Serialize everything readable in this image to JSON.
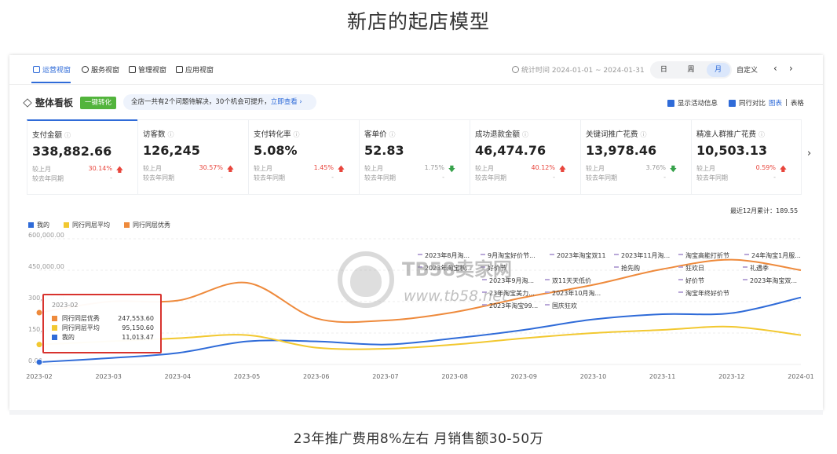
{
  "slide": {
    "title": "新店的起店模型",
    "caption": "23年推广费用8%左右 月销售额30-50万"
  },
  "topbar": {
    "tabs": [
      {
        "label": "运营视窗",
        "active": true
      },
      {
        "label": "服务视窗",
        "active": false
      },
      {
        "label": "管理视窗",
        "active": false
      },
      {
        "label": "应用视窗",
        "active": false
      }
    ],
    "stat_time": "统计时间 2024-01-01 ~ 2024-01-31",
    "periods": [
      "日",
      "周",
      "月"
    ],
    "active_period": "月",
    "custom": "自定义",
    "prev": "‹",
    "next": "›"
  },
  "section": {
    "title": "整体看板",
    "one_key": "一键转化",
    "notice": "全店一共有2个问题待解决，30个机会可提升，",
    "notice_link": "立即查看 ›",
    "show_activity": "显示活动信息",
    "peer_compare": "同行对比",
    "view_chart": "图表",
    "view_sep": " | ",
    "view_table": "表格"
  },
  "metrics": [
    {
      "label": "支付金额",
      "value": "338,882.66",
      "mom_label": "较上月",
      "mom": "30.14%",
      "dir": "up",
      "yoy_label": "较去年同期",
      "yoy": "-"
    },
    {
      "label": "访客数",
      "value": "126,245",
      "mom_label": "较上月",
      "mom": "30.57%",
      "dir": "up",
      "yoy_label": "较去年同期",
      "yoy": "-"
    },
    {
      "label": "支付转化率",
      "value": "5.08%",
      "mom_label": "较上月",
      "mom": "1.45%",
      "dir": "up",
      "yoy_label": "较去年同期",
      "yoy": "-"
    },
    {
      "label": "客单价",
      "value": "52.83",
      "mom_label": "较上月",
      "mom": "1.75%",
      "dir": "down",
      "yoy_label": "较去年同期",
      "yoy": "-"
    },
    {
      "label": "成功退款金额",
      "value": "46,474.76",
      "mom_label": "较上月",
      "mom": "40.12%",
      "dir": "up",
      "yoy_label": "较去年同期",
      "yoy": "-"
    },
    {
      "label": "关键词推广花费",
      "value": "13,978.46",
      "mom_label": "较上月",
      "mom": "3.76%",
      "dir": "down",
      "yoy_label": "较去年同期",
      "yoy": "-"
    },
    {
      "label": "精准人群推广花费",
      "value": "10,503.13",
      "mom_label": "较上月",
      "mom": "0.59%",
      "dir": "up",
      "yoy_label": "较去年同期",
      "yoy": "-"
    }
  ],
  "accum_label": "最近12月累计：189.55",
  "watermark": {
    "line1": "TB58卖家网",
    "line2": "www.tb58.net"
  },
  "chart_data": {
    "type": "line",
    "x": [
      "2023-02",
      "2023-03",
      "2023-04",
      "2023-05",
      "2023-06",
      "2023-07",
      "2023-08",
      "2023-09",
      "2023-10",
      "2023-11",
      "2023-12",
      "2024-01"
    ],
    "y_ticks": [
      "600,000.00",
      "450,000.00",
      "300,000.00",
      "150,000.00",
      "0.00"
    ],
    "ylim": [
      0,
      600000
    ],
    "legend_position": "top-left",
    "series": [
      {
        "name": "我的",
        "color": "#2f6bd8",
        "values": [
          11013,
          30000,
          55000,
          110000,
          110000,
          95000,
          125000,
          165000,
          215000,
          240000,
          245000,
          320000
        ]
      },
      {
        "name": "同行同层平均",
        "color": "#f2c830",
        "values": [
          95150,
          110000,
          125000,
          140000,
          80000,
          75000,
          95000,
          125000,
          150000,
          165000,
          180000,
          140000
        ]
      },
      {
        "name": "同行同层优秀",
        "color": "#ee8a3c",
        "values": [
          247553,
          300000,
          305000,
          390000,
          220000,
          210000,
          250000,
          320000,
          380000,
          455000,
          500000,
          450000
        ]
      }
    ],
    "annotations": [
      [
        "2023年8月淘...",
        "9月淘宝好价节...",
        "2023年淘宝双11",
        "2023年11月淘...",
        "淘宝高能打折节",
        "24年淘宝1月服..."
      ],
      [
        "2023年淘宝秋...",
        "好价节",
        "抢先购",
        "狂欢日",
        "礼遇季"
      ],
      [
        "2023年9月淘...",
        "双11天天低价",
        "好价节",
        "2023年淘宝双..."
      ],
      [
        "23年淘宝美力...",
        "2023年10月淘...",
        "淘宝年终好价节"
      ],
      [
        "2023年淘宝99...",
        "国庆狂欢"
      ]
    ],
    "tooltip": {
      "title": "2023-02",
      "rows": [
        {
          "name": "同行同层优秀",
          "value": "247,553.60",
          "color": "#ee8a3c"
        },
        {
          "name": "同行同层平均",
          "value": "95,150.60",
          "color": "#f2c830"
        },
        {
          "name": "我的",
          "value": "11,013.47",
          "color": "#2f6bd8"
        }
      ]
    }
  }
}
